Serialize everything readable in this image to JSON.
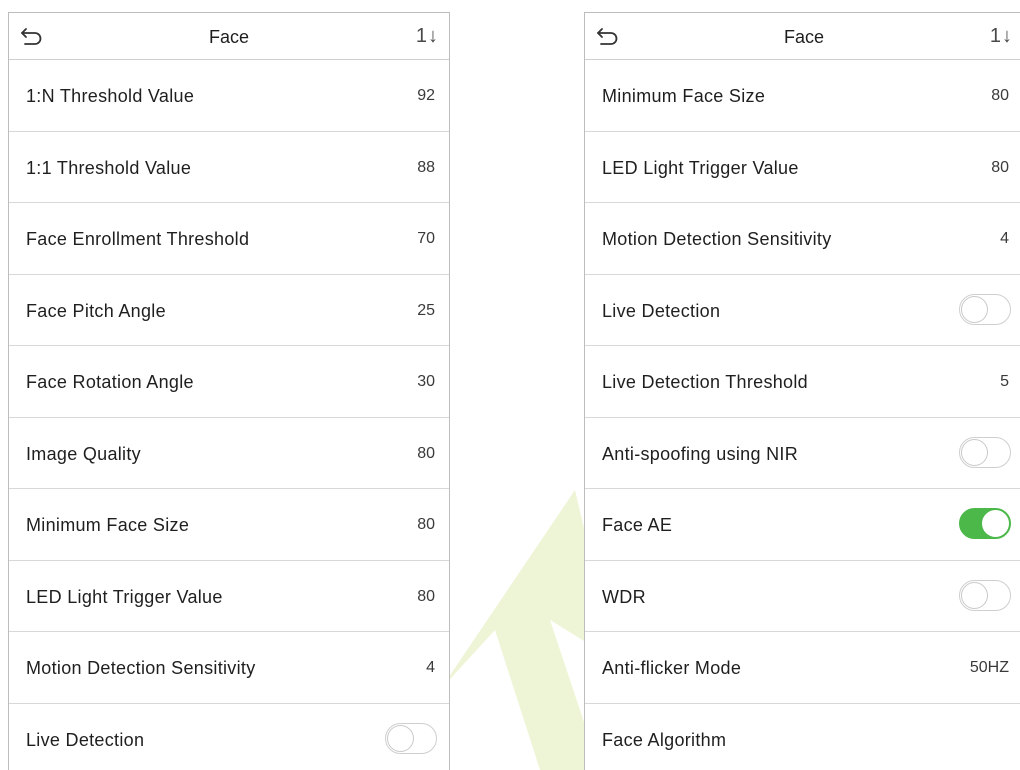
{
  "colors": {
    "toggle_on": "#4cb84a",
    "divider": "#d8d8d8",
    "watermark": "#eef5d6"
  },
  "left_screen": {
    "header": {
      "title": "Face",
      "back_icon": "back-arrow-icon",
      "sort_icon": "sort-icon",
      "sort_glyph": "1↓"
    },
    "rows": [
      {
        "label": "1:N Threshold Value",
        "value": "92"
      },
      {
        "label": "1:1 Threshold Value",
        "value": "88"
      },
      {
        "label": "Face Enrollment Threshold",
        "value": "70"
      },
      {
        "label": "Face Pitch Angle",
        "value": "25"
      },
      {
        "label": "Face Rotation Angle",
        "value": "30"
      },
      {
        "label": "Image Quality",
        "value": "80"
      },
      {
        "label": "Minimum Face Size",
        "value": "80"
      },
      {
        "label": "LED Light Trigger Value",
        "value": "80"
      },
      {
        "label": "Motion Detection Sensitivity",
        "value": "4"
      },
      {
        "label": "Live Detection",
        "toggle": false
      }
    ]
  },
  "right_screen": {
    "header": {
      "title": "Face",
      "back_icon": "back-arrow-icon",
      "sort_icon": "sort-icon",
      "sort_glyph": "1↓"
    },
    "rows": [
      {
        "label": "Minimum Face Size",
        "value": "80"
      },
      {
        "label": "LED Light Trigger Value",
        "value": "80"
      },
      {
        "label": "Motion Detection Sensitivity",
        "value": "4"
      },
      {
        "label": "Live Detection",
        "toggle": false
      },
      {
        "label": "Live Detection Threshold",
        "value": "5"
      },
      {
        "label": "Anti-spoofing using NIR",
        "toggle": false
      },
      {
        "label": "Face AE",
        "toggle": true
      },
      {
        "label": "WDR",
        "toggle": false
      },
      {
        "label": "Anti-flicker Mode",
        "value": "50HZ"
      },
      {
        "label": "Face Algorithm"
      }
    ]
  }
}
